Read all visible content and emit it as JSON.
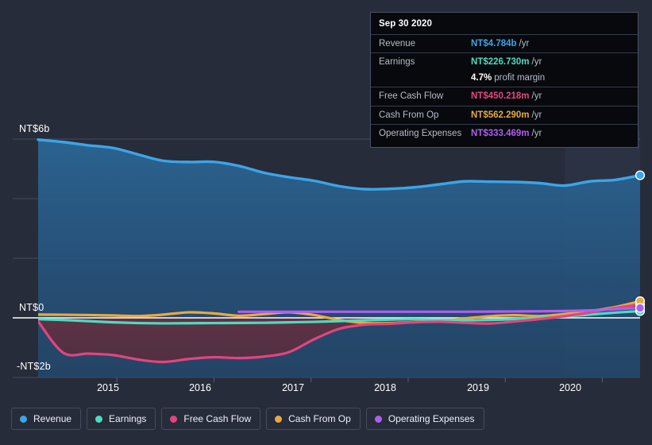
{
  "axes": {
    "y_ticks": [
      {
        "label": "NT$6b",
        "value": 6000
      },
      {
        "label": "NT$0",
        "value": 0
      },
      {
        "label": "-NT$2b",
        "value": -2000
      }
    ],
    "x_ticks": [
      "2015",
      "2016",
      "2017",
      "2018",
      "2019",
      "2020"
    ]
  },
  "tooltip": {
    "title": "Sep 30 2020",
    "rows": [
      {
        "label": "Revenue",
        "value": "NT$4.784b",
        "unit": "/yr",
        "color": "#3ba5e8"
      },
      {
        "label": "Earnings",
        "value": "NT$226.730m",
        "unit": "/yr",
        "color": "#4ddbc0"
      },
      {
        "label": "",
        "value": "4.7%",
        "unit": "profit margin",
        "color": "#ffffff",
        "sub": true
      },
      {
        "label": "Free Cash Flow",
        "value": "NT$450.218m",
        "unit": "/yr",
        "color": "#e8457f"
      },
      {
        "label": "Cash From Op",
        "value": "NT$562.290m",
        "unit": "/yr",
        "color": "#e9a93f"
      },
      {
        "label": "Operating Expenses",
        "value": "NT$333.469m",
        "unit": "/yr",
        "color": "#b05ef0"
      }
    ]
  },
  "legend": {
    "items": [
      {
        "label": "Revenue",
        "color": "#3ba5e8"
      },
      {
        "label": "Earnings",
        "color": "#4ddbc0"
      },
      {
        "label": "Free Cash Flow",
        "color": "#e0457f"
      },
      {
        "label": "Cash From Op",
        "color": "#e9a93f"
      },
      {
        "label": "Operating Expenses",
        "color": "#b05ef0"
      }
    ]
  },
  "chart_data": {
    "type": "area",
    "title": "",
    "xlabel": "",
    "ylabel": "NT$",
    "ylim": [
      -2000,
      6000
    ],
    "grid": true,
    "legend_position": "bottom",
    "currency": "NT$",
    "units": "millions",
    "x": [
      "2014-09",
      "2014-12",
      "2015-03",
      "2015-06",
      "2015-09",
      "2015-12",
      "2016-03",
      "2016-06",
      "2016-09",
      "2016-12",
      "2017-03",
      "2017-06",
      "2017-09",
      "2017-12",
      "2018-03",
      "2018-06",
      "2018-09",
      "2018-12",
      "2019-03",
      "2019-06",
      "2019-09",
      "2019-12",
      "2020-03",
      "2020-06",
      "2020-09"
    ],
    "x_tick_positions": [
      "2015",
      "2016",
      "2017",
      "2018",
      "2019",
      "2020"
    ],
    "forecast_start": "2019-12",
    "series": [
      {
        "name": "Revenue",
        "color": "#3ba5e8",
        "filled": true,
        "values": [
          5980,
          5900,
          5790,
          5700,
          5480,
          5270,
          5230,
          5235,
          5100,
          4870,
          4720,
          4600,
          4420,
          4320,
          4330,
          4380,
          4480,
          4580,
          4570,
          4560,
          4520,
          4440,
          4580,
          4630,
          4784
        ]
      },
      {
        "name": "Earnings",
        "color": "#4ddbc0",
        "values": [
          -45,
          -70,
          -110,
          -150,
          -175,
          -185,
          -180,
          -175,
          -170,
          -165,
          -150,
          -135,
          -110,
          -80,
          -60,
          -45,
          -60,
          -80,
          -70,
          -40,
          0,
          45,
          110,
          175,
          226.73
        ]
      },
      {
        "name": "Free Cash Flow",
        "color": "#e0457f",
        "values": [
          -120,
          -1170,
          -1200,
          -1250,
          -1400,
          -1480,
          -1380,
          -1320,
          -1350,
          -1300,
          -1150,
          -720,
          -370,
          -230,
          -200,
          -150,
          -130,
          -165,
          -190,
          -120,
          -40,
          60,
          180,
          330,
          450.218
        ]
      },
      {
        "name": "Cash From Op",
        "color": "#e9a93f",
        "values": [
          110,
          105,
          95,
          80,
          60,
          110,
          185,
          150,
          70,
          125,
          190,
          95,
          -70,
          -170,
          -175,
          -140,
          -95,
          -20,
          55,
          90,
          60,
          130,
          230,
          360,
          562.29
        ]
      },
      {
        "name": "Operating Expenses",
        "color": "#b05ef0",
        "start_index": 8,
        "values": [
          null,
          null,
          null,
          null,
          null,
          null,
          null,
          null,
          205,
          205,
          205,
          205,
          205,
          205,
          205,
          205,
          205,
          205,
          210,
          215,
          220,
          230,
          250,
          290,
          333.469
        ]
      }
    ]
  }
}
